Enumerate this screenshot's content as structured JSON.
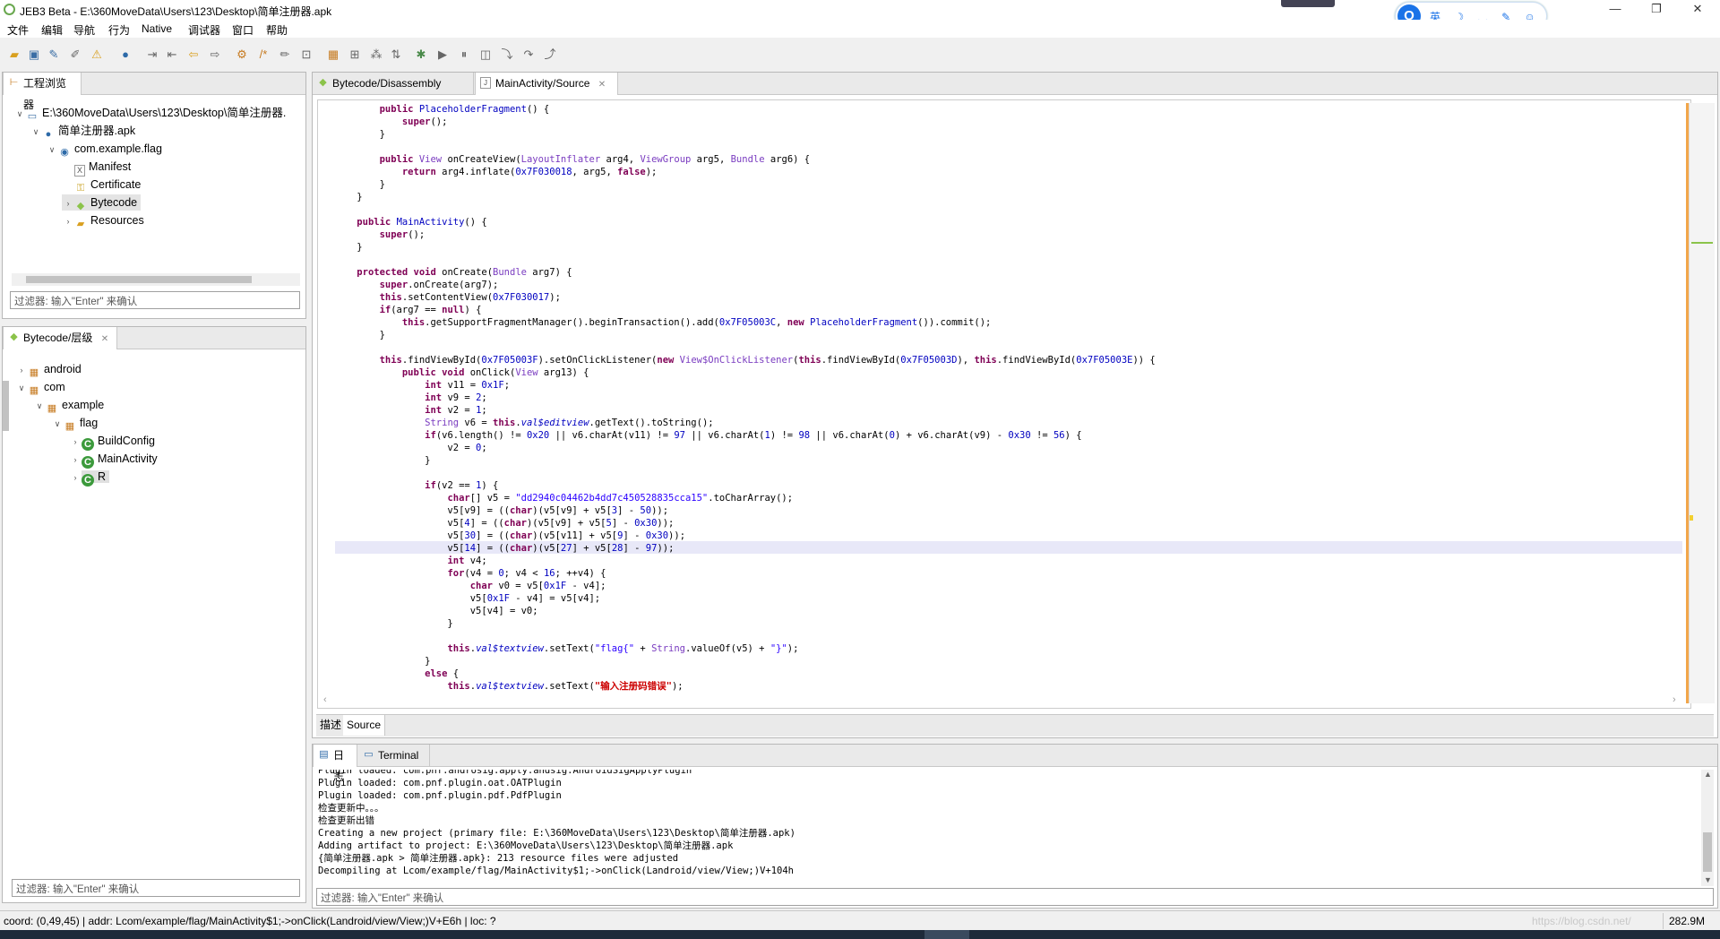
{
  "window": {
    "title": "JEB3 Beta - E:\\360MoveData\\Users\\123\\Desktop\\简单注册器.apk",
    "controls": {
      "minimize": "—",
      "maximize": "❐",
      "close": "✕"
    }
  },
  "menu": [
    "文件",
    "编辑",
    "导航",
    "行为",
    "Native",
    "调试器",
    "窗口",
    "帮助"
  ],
  "ime": {
    "logo": "Q",
    "text": "英 ☽ ‚‚ ✎ ☺ ▦"
  },
  "project_explorer": {
    "tab_label": "工程浏览器",
    "tree": [
      {
        "label": "E:\\360MoveData\\Users\\123\\Desktop\\简单注册器."
      },
      {
        "label": "简单注册器.apk"
      },
      {
        "label": "com.example.flag"
      },
      {
        "label": "Manifest"
      },
      {
        "label": "Certificate"
      },
      {
        "label": "Bytecode"
      },
      {
        "label": "Resources"
      }
    ],
    "filter_placeholder": "过滤器: 输入\"Enter\" 来确认"
  },
  "hierarchy": {
    "tab_label": "Bytecode/层级",
    "tree": [
      {
        "label": "android"
      },
      {
        "label": "com"
      },
      {
        "label": "example"
      },
      {
        "label": "flag"
      },
      {
        "label": "BuildConfig"
      },
      {
        "label": "MainActivity"
      },
      {
        "label": "R"
      }
    ],
    "filter_placeholder": "过滤器: 输入\"Enter\" 来确认"
  },
  "editor": {
    "tabs": [
      {
        "label": "Bytecode/Disassembly"
      },
      {
        "label": "MainActivity/Source"
      }
    ],
    "bottom_tabs": [
      "描述",
      "Source"
    ]
  },
  "console": {
    "tabs": [
      "日志",
      "Terminal"
    ],
    "lines": [
      "Plugin loaded: com.pnf.androsig.apply.andsig.AndroidSigApplyPlugin",
      "Plugin loaded: com.pnf.plugin.oat.OATPlugin",
      "Plugin loaded: com.pnf.plugin.pdf.PdfPlugin",
      "检查更新中。。。",
      "检查更新出错",
      "Creating a new project (primary file: E:\\360MoveData\\Users\\123\\Desktop\\简单注册器.apk)",
      "Adding artifact to project: E:\\360MoveData\\Users\\123\\Desktop\\简单注册器.apk",
      "{简单注册器.apk > 简单注册器.apk}: 213 resource files were adjusted",
      "Decompiling at Lcom/example/flag/MainActivity$1;->onClick(Landroid/view/View;)V+104h"
    ],
    "filter_placeholder": "过滤器: 输入\"Enter\" 来确认"
  },
  "status": {
    "text": "coord: (0,49,45) | addr: Lcom/example/flag/MainActivity$1;->onClick(Landroid/view/View;)V+E6h | loc: ?",
    "watermark": "https://blog.csdn.net/",
    "memory": "282.9M"
  },
  "colors": {
    "keyword": "#7f0055",
    "type": "#7a3cc0",
    "number": "#0000c0",
    "string": "#2a00ff",
    "highlight_line": "#e8e8f8",
    "ruler": "#f2a64a"
  }
}
